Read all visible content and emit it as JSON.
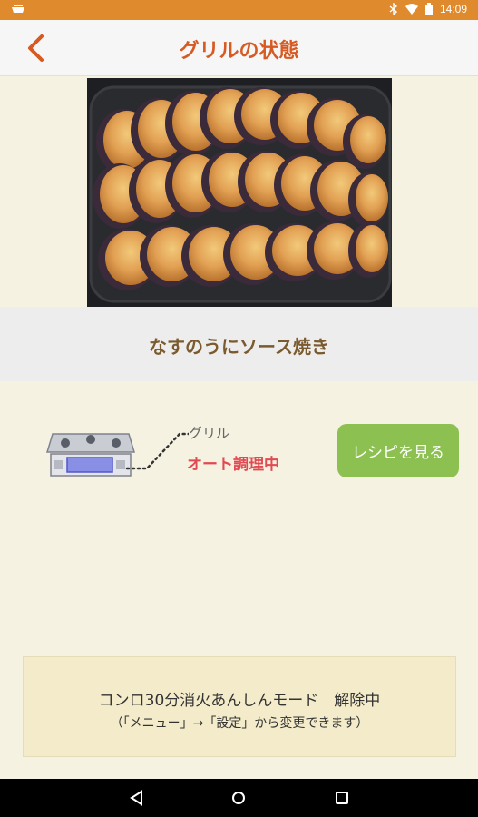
{
  "status_bar": {
    "time": "14:09",
    "icons": [
      "notification-icon",
      "bluetooth-icon",
      "wifi-icon",
      "battery-icon"
    ]
  },
  "header": {
    "title": "グリルの状態",
    "back_icon": "chevron-left-icon",
    "accent_color": "#d65a22"
  },
  "recipe": {
    "name": "なすのうにソース焼き"
  },
  "grill": {
    "label": "グリル",
    "status": "オート調理中",
    "status_color": "#e24a52"
  },
  "buttons": {
    "view_recipe": "レシピを見る",
    "view_recipe_color": "#8cc152"
  },
  "notice": {
    "line1": "コンロ30分消火あんしんモード　解除中",
    "line2": "（「メニュー」→「設定」から変更できます）"
  },
  "nav": {
    "back_icon": "nav-back-icon",
    "home_icon": "nav-home-icon",
    "recents_icon": "nav-recents-icon"
  }
}
